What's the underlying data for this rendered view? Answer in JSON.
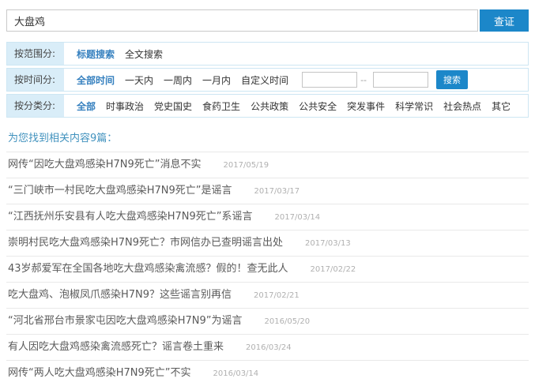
{
  "search": {
    "query": "大盘鸡",
    "placeholder": "",
    "submit_label": "查证"
  },
  "filters": [
    {
      "label": "按范围分:",
      "options": [
        {
          "label": "标题搜索",
          "selected": true
        },
        {
          "label": "全文搜索",
          "selected": false
        }
      ]
    },
    {
      "label": "按时间分:",
      "options": [
        {
          "label": "全部时间",
          "selected": true
        },
        {
          "label": "一天内",
          "selected": false
        },
        {
          "label": "一周内",
          "selected": false
        },
        {
          "label": "一月内",
          "selected": false
        },
        {
          "label": "自定义时间",
          "selected": false
        }
      ],
      "date_range": {
        "start_value": "",
        "end_value": "",
        "separator": "--",
        "search_label": "搜索"
      }
    },
    {
      "label": "按分类分:",
      "options": [
        {
          "label": "全部",
          "selected": true
        },
        {
          "label": "时事政治",
          "selected": false
        },
        {
          "label": "党史国史",
          "selected": false
        },
        {
          "label": "食药卫生",
          "selected": false
        },
        {
          "label": "公共政策",
          "selected": false
        },
        {
          "label": "公共安全",
          "selected": false
        },
        {
          "label": "突发事件",
          "selected": false
        },
        {
          "label": "科学常识",
          "selected": false
        },
        {
          "label": "社会热点",
          "selected": false
        },
        {
          "label": "其它",
          "selected": false
        }
      ]
    }
  ],
  "results": {
    "header": "为您找到相关内容9篇：",
    "items": [
      {
        "title": "网传“因吃大盘鸡感染H7N9死亡”消息不实",
        "date": "2017/05/19"
      },
      {
        "title": "“三门峡市一村民吃大盘鸡感染H7N9死亡”是谣言",
        "date": "2017/03/17"
      },
      {
        "title": "“江西抚州乐安县有人吃大盘鸡感染H7N9死亡”系谣言",
        "date": "2017/03/14"
      },
      {
        "title": "崇明村民吃大盘鸡感染H7N9死亡？市网信办已查明谣言出处",
        "date": "2017/03/13"
      },
      {
        "title": "43岁郝爱军在全国各地吃大盘鸡感染禽流感？假的！查无此人",
        "date": "2017/02/22"
      },
      {
        "title": "吃大盘鸡、泡椒凤爪感染H7N9？这些谣言别再信",
        "date": "2017/02/21"
      },
      {
        "title": "“河北省邢台市景家屯因吃大盘鸡感染H7N9”为谣言",
        "date": "2016/05/20"
      },
      {
        "title": "有人因吃大盘鸡感染禽流感死亡？谣言卷土重来",
        "date": "2016/03/24"
      },
      {
        "title": "网传“两人吃大盘鸡感染H7N9死亡”不实",
        "date": "2016/03/14"
      }
    ]
  },
  "colors": {
    "primary_blue": "#1c87c9",
    "selected_link_blue": "#3580bf",
    "results_header_blue": "#4192be",
    "filter_label_bg": "#d9edf8",
    "filter_border": "#cde6f3",
    "title_gray": "#5a5a5a",
    "date_gray": "#b0b0b0"
  }
}
